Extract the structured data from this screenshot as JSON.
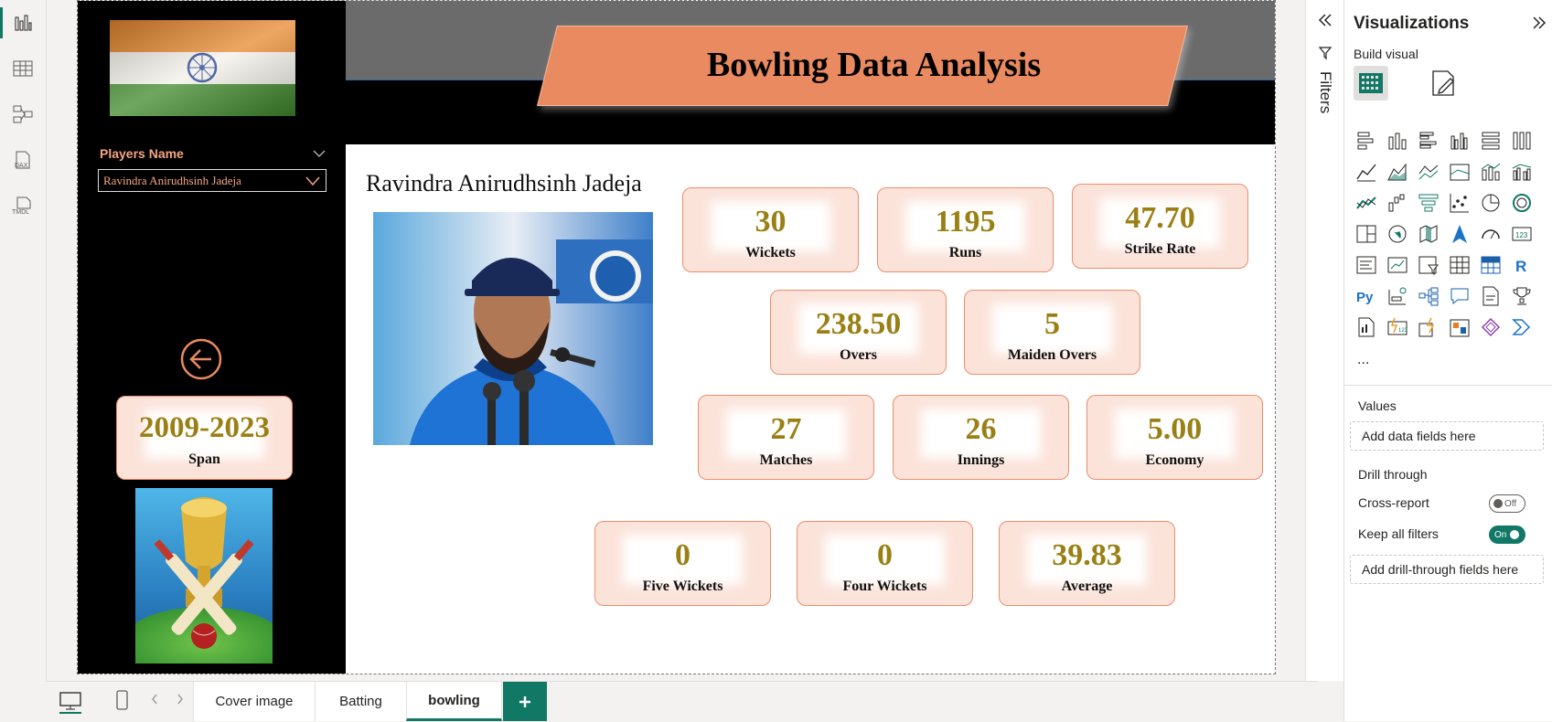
{
  "report": {
    "title": "Bowling Data Analysis",
    "slicer": {
      "label": "Players Name",
      "value": "Ravindra Anirudhsinh Jadeja"
    },
    "player_name": "Ravindra Anirudhsinh Jadeja",
    "span": {
      "value": "2009-2023",
      "label": "Span"
    },
    "cards": [
      {
        "value": "30",
        "label": "Wickets"
      },
      {
        "value": "1195",
        "label": "Runs"
      },
      {
        "value": "47.70",
        "label": "Strike Rate"
      },
      {
        "value": "238.50",
        "label": "Overs"
      },
      {
        "value": "5",
        "label": "Maiden Overs"
      },
      {
        "value": "27",
        "label": "Matches"
      },
      {
        "value": "26",
        "label": "Innings"
      },
      {
        "value": "5.00",
        "label": "Economy"
      },
      {
        "value": "0",
        "label": "Five Wickets"
      },
      {
        "value": "0",
        "label": "Four Wickets"
      },
      {
        "value": "39.83",
        "label": "Average"
      }
    ],
    "colors": {
      "card_value": "#9a8014",
      "accent": "#ea8a60",
      "card_bg": "#fbe3da"
    }
  },
  "tabs": [
    {
      "label": "Cover image"
    },
    {
      "label": "Batting"
    },
    {
      "label": "bowling",
      "active": true
    }
  ],
  "filters_pane": {
    "label": "Filters"
  },
  "visualizations": {
    "title": "Visualizations",
    "build_visual": "Build visual",
    "values_label": "Values",
    "values_placeholder": "Add data fields here",
    "drill_through_label": "Drill through",
    "cross_report_label": "Cross-report",
    "cross_report_state": "Off",
    "keep_filters_label": "Keep all filters",
    "keep_filters_state": "On",
    "drill_placeholder": "Add drill-through fields here",
    "more": "..."
  }
}
